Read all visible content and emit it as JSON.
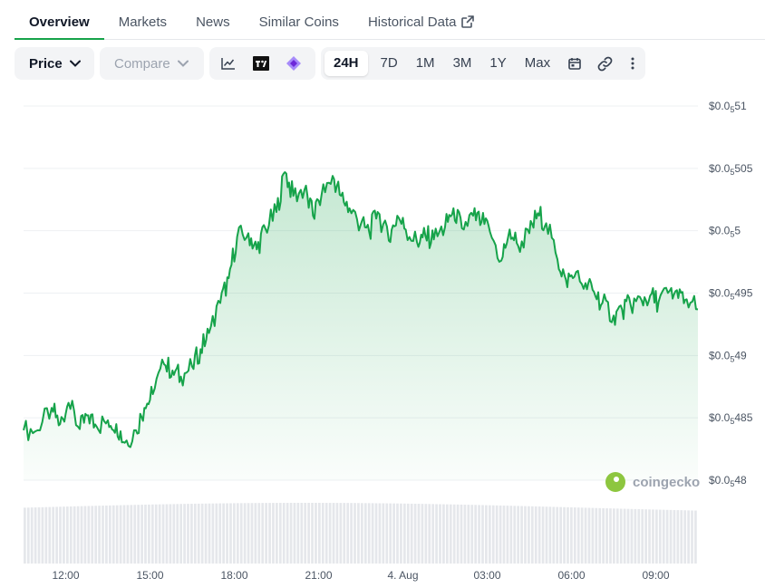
{
  "tabs": [
    {
      "label": "Overview",
      "active": true
    },
    {
      "label": "Markets"
    },
    {
      "label": "News"
    },
    {
      "label": "Similar Coins"
    },
    {
      "label": "Historical Data",
      "external_icon": "external-link-icon"
    }
  ],
  "toolbar": {
    "price_label": "Price",
    "compare_label": "Compare",
    "chart_type_icons": [
      "line-chart-icon",
      "tradingview-icon",
      "candlestick-icon"
    ],
    "ranges": [
      "24H",
      "7D",
      "1M",
      "3M",
      "1Y",
      "Max"
    ],
    "active_range": "24H",
    "extra_icons": [
      "calendar-icon",
      "link-icon",
      "more-vertical-icon"
    ]
  },
  "watermark": "coingecko",
  "colors": {
    "line": "#16a34a",
    "tab_accent": "#16a34a",
    "volume": "#e5e7eb"
  },
  "chart_data": {
    "type": "area",
    "y_tick_labels": [
      {
        "prefix": "$0.0",
        "sub": "5",
        "suffix": "51"
      },
      {
        "prefix": "$0.0",
        "sub": "5",
        "suffix": "505"
      },
      {
        "prefix": "$0.0",
        "sub": "5",
        "suffix": "5"
      },
      {
        "prefix": "$0.0",
        "sub": "5",
        "suffix": "495"
      },
      {
        "prefix": "$0.0",
        "sub": "5",
        "suffix": "49"
      },
      {
        "prefix": "$0.0",
        "sub": "5",
        "suffix": "485"
      },
      {
        "prefix": "$0.0",
        "sub": "5",
        "suffix": "48"
      }
    ],
    "y_ticks": [
      5.51e-06,
      5.505e-06,
      5.5e-06,
      5.495e-06,
      5.49e-06,
      5.485e-06,
      5.48e-06
    ],
    "ylim": [
      5.48e-06,
      5.51e-06
    ],
    "x_tick_labels": [
      "12:00",
      "15:00",
      "18:00",
      "21:00",
      "4. Aug",
      "03:00",
      "06:00",
      "09:00"
    ],
    "x_ticks": [
      1.5,
      4.5,
      7.5,
      10.5,
      13.5,
      16.5,
      19.5,
      22.5
    ],
    "xlim": [
      0,
      24
    ],
    "grid": true,
    "series": [
      {
        "x": [
          0,
          0.5,
          1,
          1.3,
          1.6,
          2,
          2.3,
          2.6,
          3,
          3.3,
          3.6,
          4,
          4.3,
          4.6,
          5,
          5.3,
          5.6,
          6,
          6.3,
          6.6,
          7,
          7.3,
          7.6,
          8,
          8.3,
          8.6,
          9,
          9.3,
          9.6,
          10,
          10.3,
          10.6,
          11,
          11.3,
          11.6,
          12,
          12.3,
          12.6,
          13,
          13.3,
          13.6,
          14,
          14.3,
          14.6,
          15,
          15.3,
          15.6,
          16,
          16.3,
          16.6,
          17,
          17.3,
          17.6,
          18,
          18.3,
          18.6,
          19,
          19.3,
          19.6,
          20,
          20.3,
          20.6,
          21,
          21.3,
          21.6,
          22,
          22.3,
          22.6,
          23,
          23.3,
          23.6,
          24
        ],
        "y": [
          5.484e-06,
          5.484e-06,
          5.4858e-06,
          5.4845e-06,
          5.4862e-06,
          5.4841e-06,
          5.4852e-06,
          5.4843e-06,
          5.4848e-06,
          5.4845e-06,
          5.483e-06,
          5.484e-06,
          5.4858e-06,
          5.4869e-06,
          5.4893e-06,
          5.4888e-06,
          5.4883e-06,
          5.4891e-06,
          5.4905e-06,
          5.4918e-06,
          5.4942e-06,
          5.4962e-06,
          5.4995e-06,
          5.4998e-06,
          5.4985e-06,
          5.5002e-06,
          5.5015e-06,
          5.5047e-06,
          5.5028e-06,
          5.5033e-06,
          5.5012e-06,
          5.5028e-06,
          5.5044e-06,
          5.5028e-06,
          5.5018e-06,
          5.5005e-06,
          5.4999e-06,
          5.5015e-06,
          5.4992e-06,
          5.5012e-06,
          5.5001e-06,
          5.4991e-06,
          5.4996e-06,
          5.4993e-06,
          5.5003e-06,
          5.5018e-06,
          5.5002e-06,
          5.5012e-06,
          5.5007e-06,
          5.4999e-06,
          5.4976e-06,
          5.5001e-06,
          5.4988e-06,
          5.4998e-06,
          5.5014e-06,
          5.5006e-06,
          5.4977e-06,
          5.4961e-06,
          5.4963e-06,
          5.4958e-06,
          5.4951e-06,
          5.4942e-06,
          5.4932e-06,
          5.4937e-06,
          5.4941e-06,
          5.4944e-06,
          5.4948e-06,
          5.4943e-06,
          5.4952e-06,
          5.4946e-06,
          5.4945e-06,
          5.4937e-06
        ]
      }
    ]
  }
}
